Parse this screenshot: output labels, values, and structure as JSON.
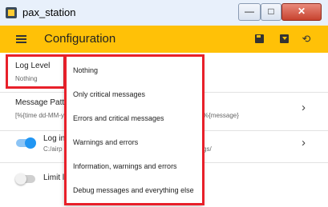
{
  "window": {
    "title": "pax_station",
    "minimize": "—",
    "maximize": "□",
    "close": "✕"
  },
  "appbar": {
    "title": "Configuration",
    "icons": [
      "menu-icon",
      "save-icon",
      "download-icon",
      "restore-icon"
    ]
  },
  "settings": {
    "log_level": {
      "label": "Log Level",
      "value": "Nothing"
    },
    "message_pattern": {
      "label": "Message Patte",
      "value_left": "[%{time dd-MM-y",
      "value_right": "%{message}"
    },
    "log_file": {
      "label": "Log in",
      "value_left": "C:/airp",
      "value_right": "gs/",
      "enabled": true
    },
    "limit": {
      "label": "Limit l",
      "enabled": false
    }
  },
  "dropdown": {
    "options": [
      "Nothing",
      "Only critical messages",
      "Errors and critical messages",
      "Warnings and errors",
      "Information, warnings and errors",
      "Debug messages and everything else"
    ]
  },
  "colors": {
    "appbar": "#ffc107",
    "accent": "#2196f3",
    "highlight": "#e8202a"
  }
}
